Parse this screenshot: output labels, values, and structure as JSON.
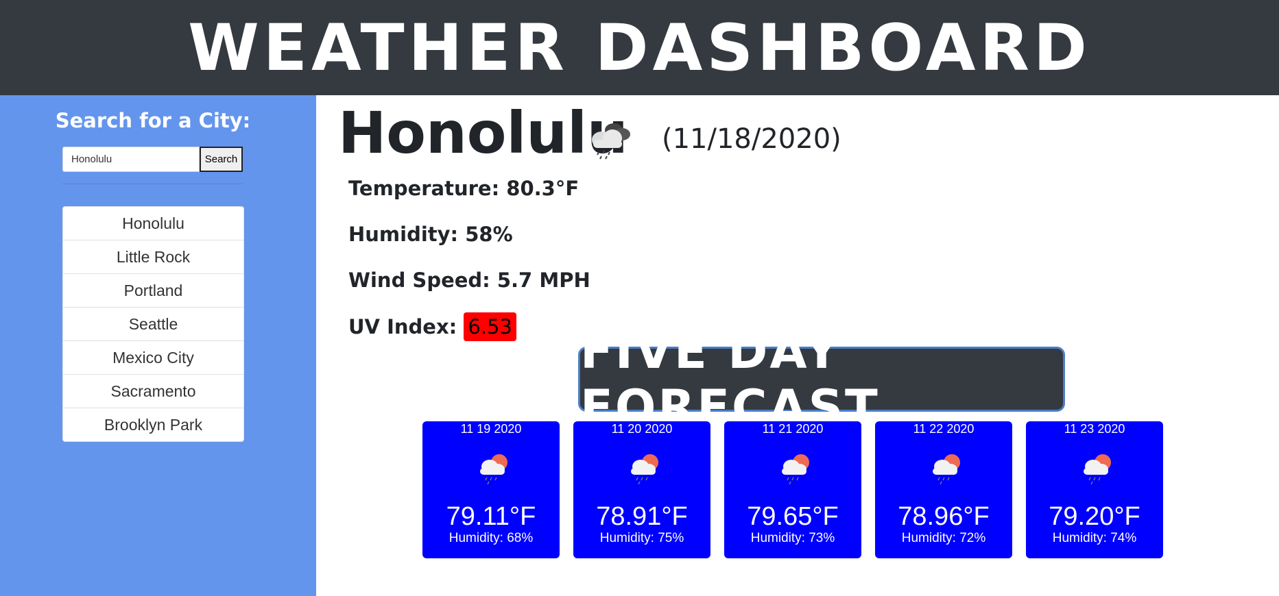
{
  "header": {
    "title": "WEATHER DASHBOARD"
  },
  "sidebar": {
    "heading": "Search for a City:",
    "search": {
      "value": "Honolulu",
      "placeholder": ""
    },
    "search_button": "Search",
    "cities": [
      "Honolulu",
      "Little Rock",
      "Portland",
      "Seattle",
      "Mexico City",
      "Sacramento",
      "Brooklyn Park"
    ]
  },
  "current": {
    "city": "Honolulu",
    "date": "(11/18/2020)",
    "icon": "rain-cloud-icon",
    "temperature": "Temperature: 80.3°F",
    "humidity": "Humidity: 58%",
    "wind": "Wind Speed: 5.7 MPH",
    "uv_label": "UV Index:",
    "uv_value": "6.53",
    "uv_color": "#ff0000"
  },
  "forecast": {
    "title": "FIVE DAY FORECAST",
    "days": [
      {
        "date": "11 19 2020",
        "temp": "79.11°F",
        "humidity": "Humidity: 68%",
        "icon": "sun-rain-cloud-icon"
      },
      {
        "date": "11 20 2020",
        "temp": "78.91°F",
        "humidity": "Humidity: 75%",
        "icon": "sun-rain-cloud-icon"
      },
      {
        "date": "11 21 2020",
        "temp": "79.65°F",
        "humidity": "Humidity: 73%",
        "icon": "sun-rain-cloud-icon"
      },
      {
        "date": "11 22 2020",
        "temp": "78.96°F",
        "humidity": "Humidity: 72%",
        "icon": "sun-rain-cloud-icon"
      },
      {
        "date": "11 23 2020",
        "temp": "79.20°F",
        "humidity": "Humidity: 74%",
        "icon": "sun-rain-cloud-icon"
      }
    ]
  },
  "colors": {
    "header_bg": "#343a40",
    "sidebar_bg": "#6495ed",
    "card_bg": "#0000ff"
  }
}
